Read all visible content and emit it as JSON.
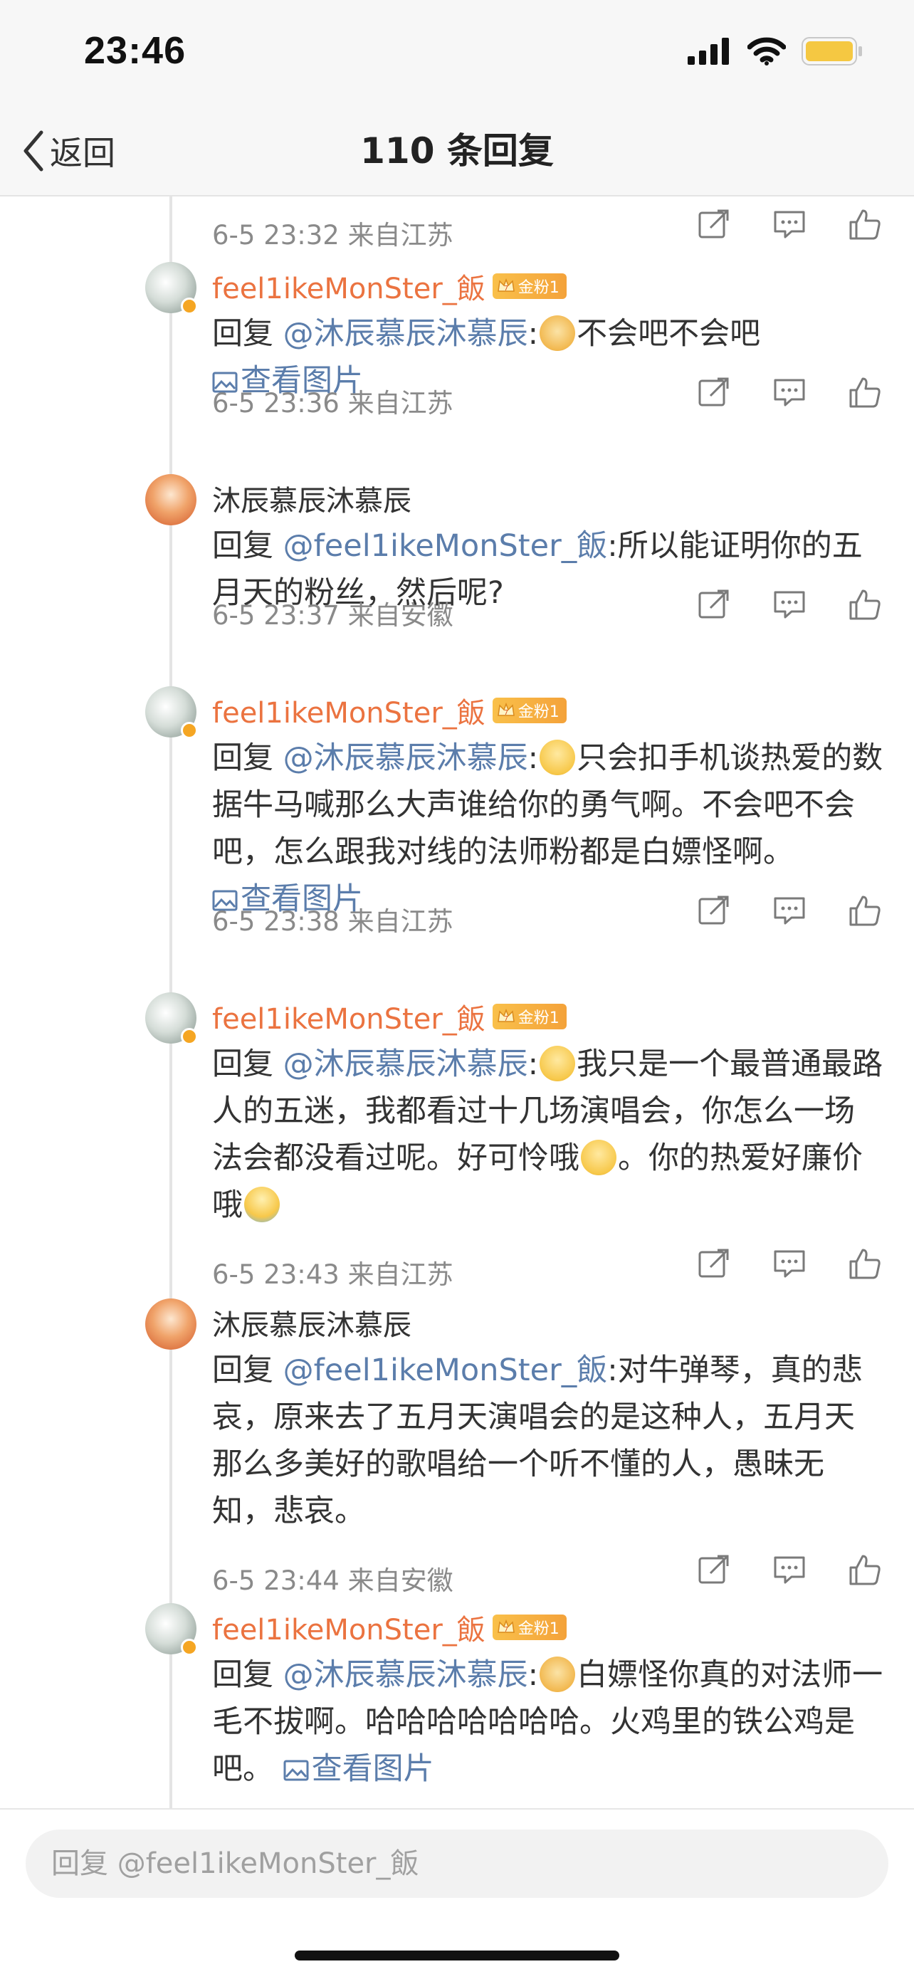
{
  "status_bar": {
    "time": "23:46"
  },
  "nav": {
    "back_label": "返回",
    "title": "110 条回复"
  },
  "colors": {
    "username_orange": "#eb7340",
    "link_blue": "#5b7dab",
    "meta_gray": "#8a8a8a",
    "badge_gold": "#f4a23a"
  },
  "top_meta": {
    "time": "6-5 23:32",
    "location": "来自江苏"
  },
  "comments": [
    {
      "user": "feel1ikeMonSter_飯",
      "badge": "金粉1",
      "badge_level": "7",
      "reply_prefix": "回复 ",
      "mention": "@沐辰慕辰沐慕辰",
      "colon": ":",
      "text": "不会吧不会吧 ",
      "emoji": "doge-emoji",
      "picture_link": "查看图片",
      "time": "6-5 23:36",
      "location": "来自江苏"
    },
    {
      "user": "沐辰慕辰沐慕辰",
      "reply_prefix": "回复 ",
      "mention": "@feel1ikeMonSter_飯",
      "colon": ":",
      "text": "所以能证明你的五月天的粉丝，然后呢?",
      "time": "6-5 23:37",
      "location": "来自安徽"
    },
    {
      "user": "feel1ikeMonSter_飯",
      "badge": "金粉1",
      "badge_level": "7",
      "reply_prefix": "回复 ",
      "mention": "@沐辰慕辰沐慕辰",
      "colon": ":",
      "text": "只会扣手机谈热爱的数据牛马喊那么大声谁给你的勇气啊。不会吧不会吧，怎么跟我对线的法师粉都是白嫖怪啊。 ",
      "emoji": "sad-emoji",
      "picture_link": "查看图片",
      "time": "6-5 23:38",
      "location": "来自江苏"
    },
    {
      "user": "feel1ikeMonSter_飯",
      "badge": "金粉1",
      "badge_level": "7",
      "reply_prefix": "回复 ",
      "mention": "@沐辰慕辰沐慕辰",
      "colon": ":",
      "text_a": "我只是一个最普通最路人的五迷，我都看过十几场演唱会，你怎么一场法会都没看过呢。好可怜哦",
      "text_b": "。你的热爱好廉价哦",
      "emoji": "sad-emoji",
      "emoji_b": "eye-roll-emoji",
      "emoji_c": "crying-emoji",
      "time": "6-5 23:43",
      "location": "来自江苏"
    },
    {
      "user": "沐辰慕辰沐慕辰",
      "reply_prefix": "回复 ",
      "mention": "@feel1ikeMonSter_飯",
      "colon": ":",
      "text": "对牛弹琴，真的悲哀，原来去了五月天演唱会的是这种人，五月天那么多美好的歌唱给一个听不懂的人，愚昧无知，悲哀。",
      "time": "6-5 23:44",
      "location": "来自安徽"
    },
    {
      "user": "feel1ikeMonSter_飯",
      "badge": "金粉1",
      "badge_level": "7",
      "reply_prefix": "回复 ",
      "mention": "@沐辰慕辰沐慕辰",
      "colon": ":",
      "text": "白嫖怪你真的对法师一毛不拔啊。哈哈哈哈哈哈哈。火鸡里的铁公鸡是吧。 ",
      "emoji": "doge-emoji",
      "picture_link": "查看图片"
    }
  ],
  "reply_box": {
    "placeholder": "回复 @feel1ikeMonSter_飯"
  }
}
